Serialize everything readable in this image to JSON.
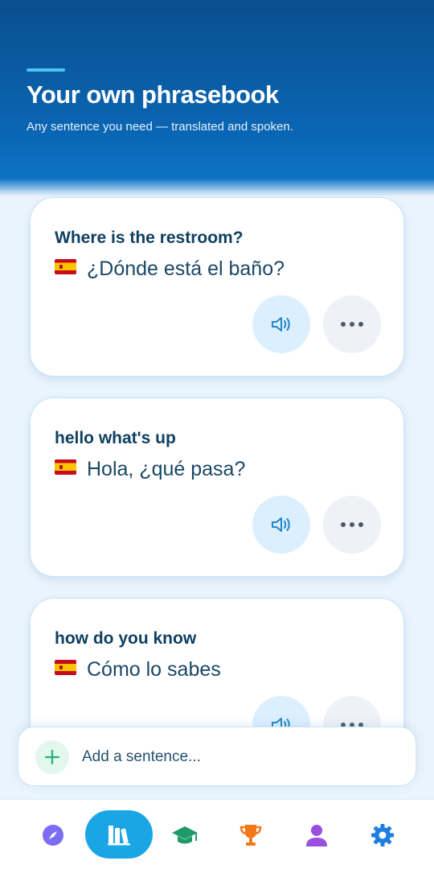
{
  "header": {
    "title": "Your own phrasebook",
    "subtitle": "Any sentence you need — translated and spoken."
  },
  "phrases": [
    {
      "english": "Where is the restroom?",
      "flag": "spain-flag-icon",
      "translation": "¿Dónde está el baño?"
    },
    {
      "english": "hello what's up",
      "flag": "spain-flag-icon",
      "translation": "Hola, ¿qué pasa?"
    },
    {
      "english": "how do you know",
      "flag": "spain-flag-icon",
      "translation": "Cómo lo sabes"
    }
  ],
  "add_bar": {
    "placeholder": "Add a sentence..."
  },
  "nav": {
    "items": [
      {
        "icon": "compass-icon",
        "active": false
      },
      {
        "icon": "books-icon",
        "active": true
      },
      {
        "icon": "graduation-cap-icon",
        "active": false
      },
      {
        "icon": "trophy-icon",
        "active": false
      },
      {
        "icon": "profile-icon",
        "active": false
      },
      {
        "icon": "settings-gear-icon",
        "active": false
      }
    ]
  },
  "colors": {
    "header_bg": "#0a5ea8",
    "accent_line": "#4fc3f7",
    "title_text": "#0f3f61",
    "speak_button_bg": "#dcefff",
    "nav_active_bg": "#1aa6e4",
    "add_plus": "#22b573"
  }
}
